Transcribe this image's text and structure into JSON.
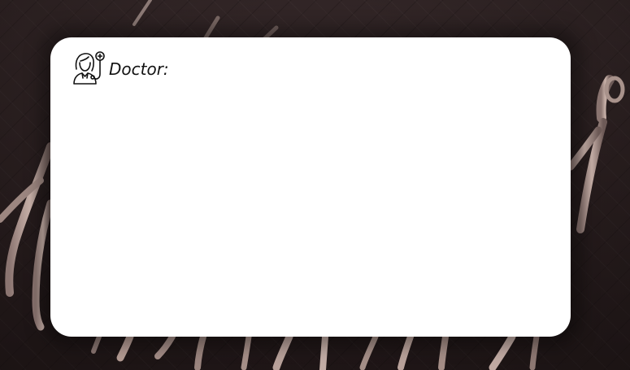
{
  "speaker": {
    "label": "Doctor:",
    "icon": "doctor-icon"
  },
  "message": {
    "text": ""
  },
  "colors": {
    "card_background": "#ffffff",
    "backdrop": "#2e2223",
    "text": "#111111"
  }
}
